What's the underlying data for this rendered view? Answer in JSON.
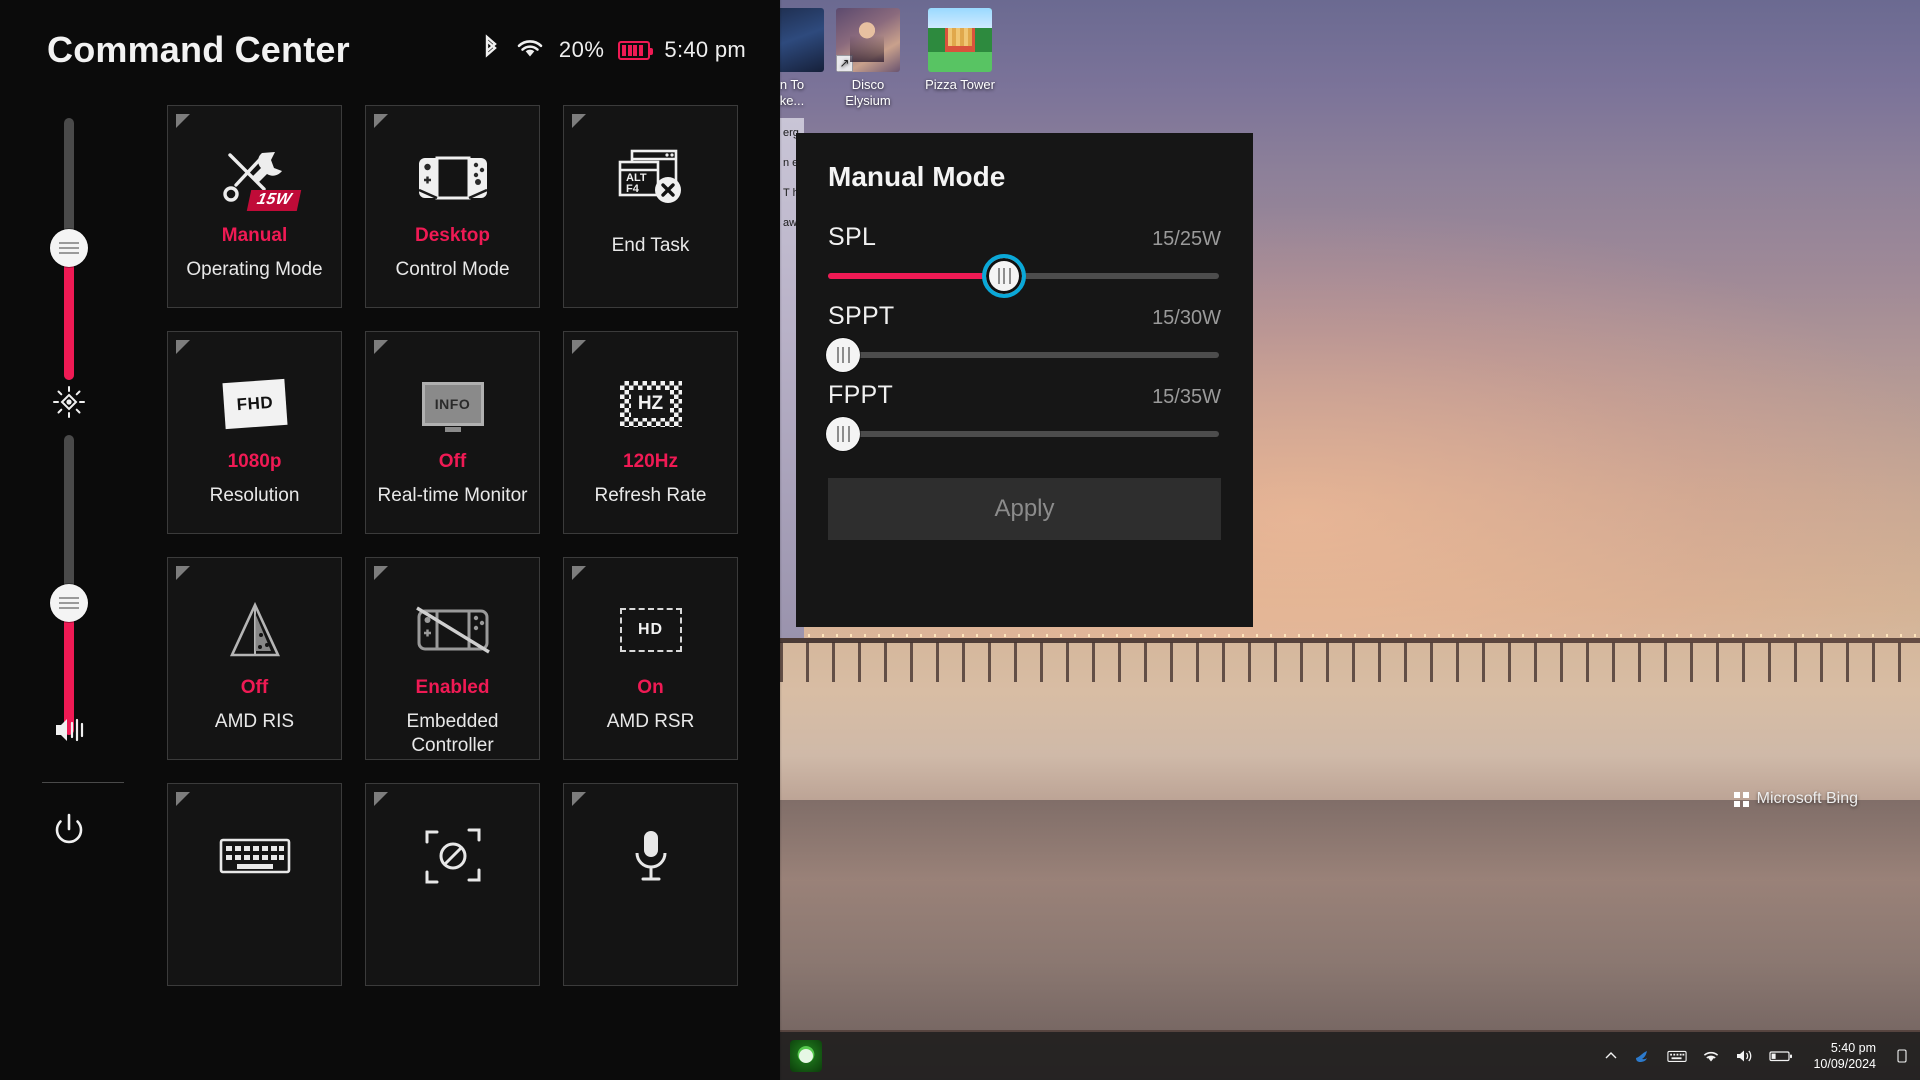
{
  "command_center": {
    "title": "Command Center",
    "status": {
      "bluetooth_icon": "bluetooth-icon",
      "wifi_icon": "wifi-icon",
      "battery_percent": "20%",
      "battery_icon": "battery-icon",
      "time": "5:40 pm"
    },
    "rail": {
      "brightness_icon": "brightness-icon",
      "volume_icon": "volume-icon",
      "power_icon": "power-icon",
      "brightness_value": 52,
      "volume_value": 42
    },
    "tiles": [
      {
        "icon": "tools-15w-icon",
        "badge": "15W",
        "value": "Manual",
        "label": "Operating Mode",
        "value_color": "#ef1a54"
      },
      {
        "icon": "handheld-icon",
        "badge": "",
        "value": "Desktop",
        "label": "Control Mode",
        "value_color": "#ef1a54"
      },
      {
        "icon": "end-task-icon",
        "badge": "",
        "value": "",
        "label": "End Task",
        "value_color": "#ef1a54"
      },
      {
        "icon": "fhd-icon",
        "badge": "",
        "value": "1080p",
        "label": "Resolution",
        "value_color": "#ef1a54"
      },
      {
        "icon": "info-icon",
        "badge": "",
        "value": "Off",
        "label": "Real-time Monitor",
        "value_color": "#ef1a54"
      },
      {
        "icon": "hz-icon",
        "badge": "",
        "value": "120Hz",
        "label": "Refresh Rate",
        "value_color": "#ef1a54"
      },
      {
        "icon": "amd-ris-icon",
        "badge": "",
        "value": "Off",
        "label": "AMD RIS",
        "value_color": "#ef1a54"
      },
      {
        "icon": "controller-off-icon",
        "badge": "",
        "value": "Enabled",
        "label": "Embedded Controller",
        "value_color": "#ef1a54"
      },
      {
        "icon": "amd-rsr-hd-icon",
        "badge": "",
        "value": "On",
        "label": "AMD RSR",
        "value_color": "#ef1a54"
      },
      {
        "icon": "keyboard-icon",
        "badge": "",
        "value": "",
        "label": "",
        "value_color": "#ef1a54"
      },
      {
        "icon": "screenshot-icon",
        "badge": "",
        "value": "",
        "label": "",
        "value_color": "#ef1a54"
      },
      {
        "icon": "microphone-mute-icon",
        "badge": "",
        "value": "",
        "label": "",
        "value_color": "#ef1a54"
      }
    ]
  },
  "dialog": {
    "title": "Manual Mode",
    "sliders": [
      {
        "name": "SPL",
        "value": "15/25W",
        "percent": 45,
        "focused": true
      },
      {
        "name": "SPPT",
        "value": "15/30W",
        "percent": 0,
        "focused": false
      },
      {
        "name": "FPPT",
        "value": "15/35W",
        "percent": 0,
        "focused": false
      }
    ],
    "apply_label": "Apply"
  },
  "desktop": {
    "icons": [
      {
        "label": "n To\nke...",
        "thumb": "thumb-cut",
        "shortcut": "↗"
      },
      {
        "label": "Disco\nElysium",
        "thumb": "thumb-disco",
        "shortcut": "↗"
      },
      {
        "label": "Pizza Tower",
        "thumb": "thumb-pizza",
        "shortcut": ""
      }
    ],
    "watermark": "Microsoft Bing"
  },
  "taskbar": {
    "show_hidden_icons": "chevron-up-icon",
    "tray": [
      "dolphin-icon",
      "keyboard-icon",
      "wifi-icon",
      "speaker-icon",
      "battery-icon"
    ],
    "clock_time": "5:40 pm",
    "clock_date": "10/09/2024",
    "notification_icon": "notification-icon"
  },
  "colors": {
    "accent_pink": "#ef1a54",
    "focus_cyan": "#0aa8d8",
    "panel_bg": "#0b0b0b",
    "tile_bg": "#141414",
    "tile_border": "#3b3b3b",
    "dialog_bg": "#161616",
    "muted_text": "#9a9a9a"
  }
}
